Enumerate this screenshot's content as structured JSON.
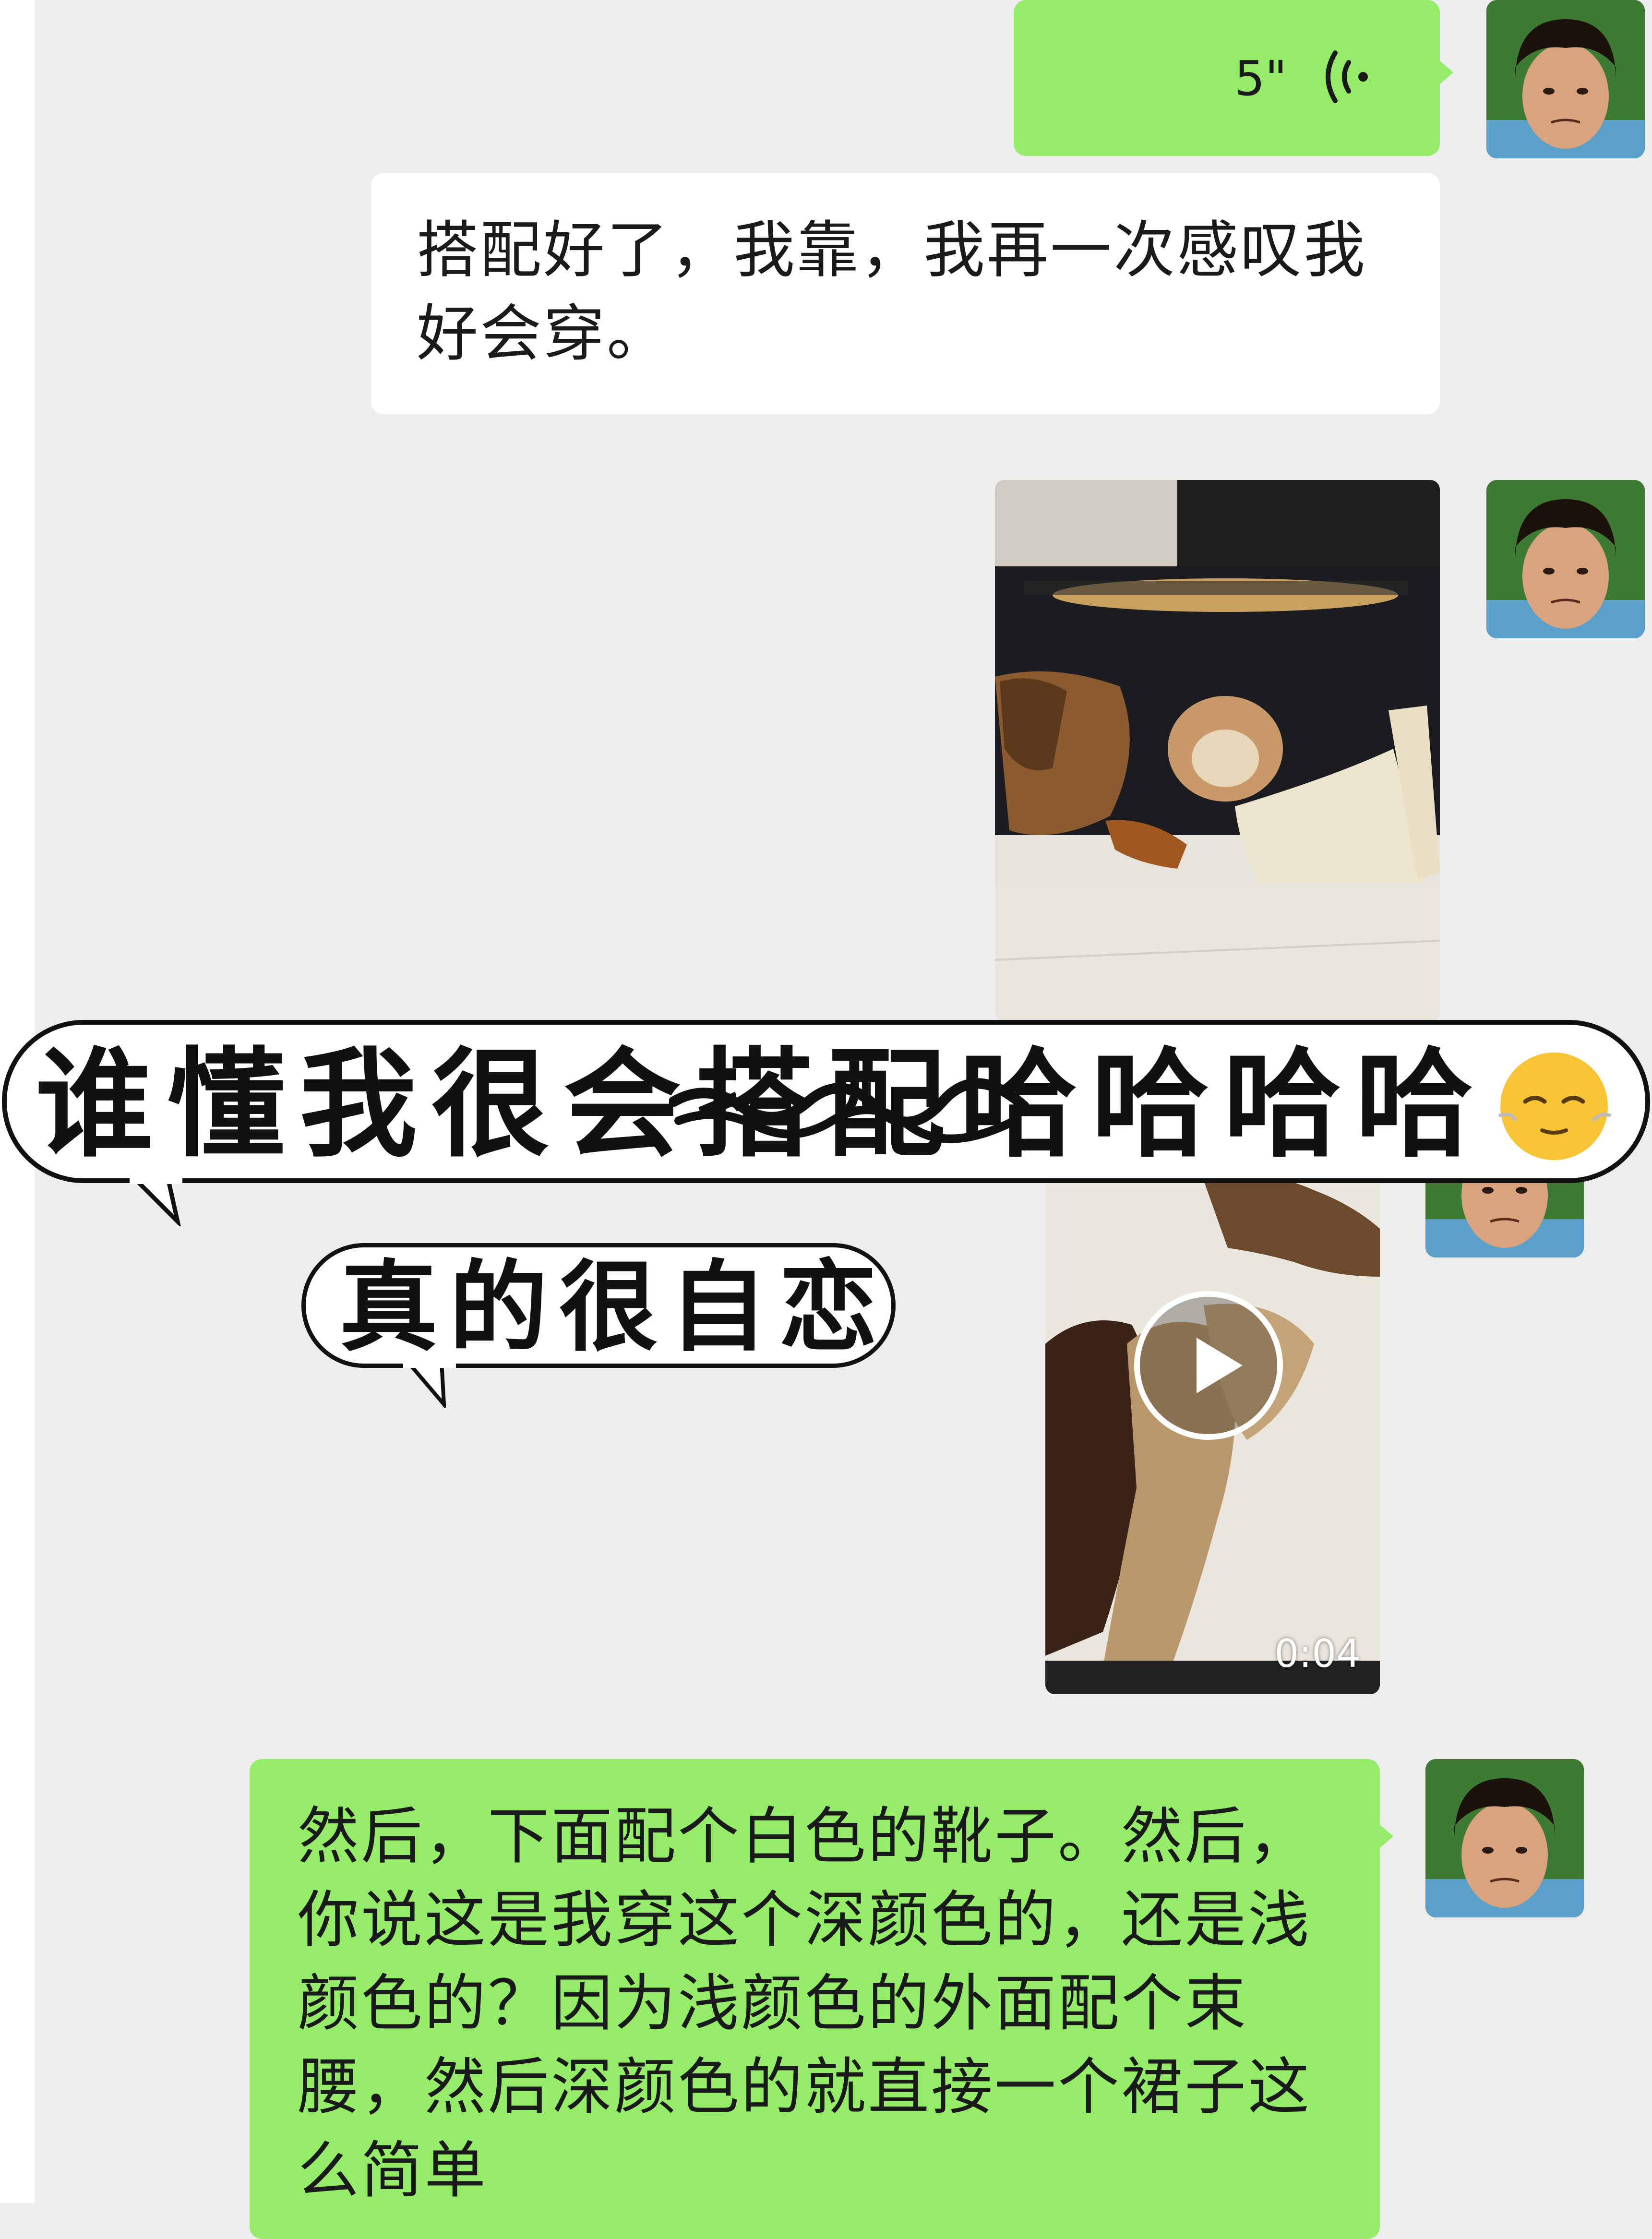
{
  "chat": {
    "voice_message": {
      "duration": "5\""
    },
    "text_message_1": {
      "text": "搭配好了，我靠，我再一次感叹我好会穿。"
    },
    "video_message": {
      "duration": "0:04"
    },
    "text_message_2": {
      "text": "然后，下面配个白色的靴子。然后，你说这是我穿这个深颜色的，还是浅颜色的？因为浅颜色的外面配个束腰，然后深颜色的就直接一个裙子这么简单"
    }
  },
  "overlay": {
    "caption": "谁懂我很会搭配哈哈哈哈",
    "sub_caption": "真的很自恋",
    "emoji": "relieved-face-emoji"
  },
  "colors": {
    "background": "#ededed",
    "sent_bubble": "#95ec69",
    "received_bubble": "#ffffff"
  },
  "icons": {
    "voice": "voice-wave-icon",
    "play": "play-icon"
  }
}
